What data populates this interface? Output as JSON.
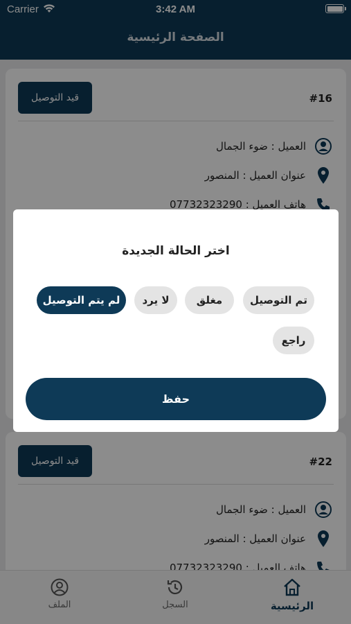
{
  "status_bar": {
    "carrier": "Carrier",
    "time": "3:42 AM"
  },
  "header": {
    "title": "الصفحة الرئيسية"
  },
  "orders": [
    {
      "number": "#16",
      "status_label": "قيد التوصيل",
      "customer": "العميل : ضوء الجمال",
      "address": "عنوان العميل : المنصور",
      "phone": "هاتف العميل : 07732323290"
    },
    {
      "number": "#22",
      "status_label": "قيد التوصيل",
      "customer": "العميل : ضوء الجمال",
      "address": "عنوان العميل : المنصور",
      "phone": "هاتف العميل : 07732323290"
    }
  ],
  "dialog": {
    "title": "اختر الحالة الجديدة",
    "options": [
      "تم التوصيل",
      "مغلق",
      "لا يرد",
      "لم يتم التوصيل",
      "راجع"
    ],
    "selected": "لم يتم التوصيل",
    "save_label": "حفظ"
  },
  "bottom_nav": {
    "home": "الرئيسية",
    "history": "السجل",
    "profile": "الملف"
  },
  "colors": {
    "primary": "#0e3a57",
    "chip": "#e4e4e4",
    "accent_icon": "#0e3a57"
  }
}
